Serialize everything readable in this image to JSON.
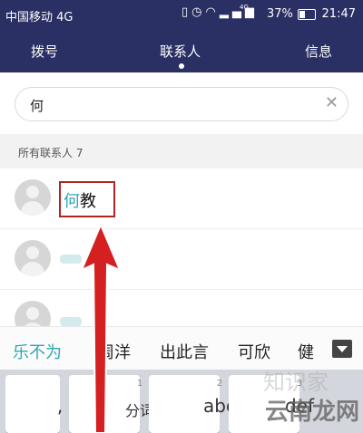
{
  "status": {
    "carrier": "中国移动 4G",
    "network": "4G",
    "battery": "37%",
    "time": "21:47"
  },
  "tabs": [
    {
      "label": "拨号"
    },
    {
      "label": "联系人"
    },
    {
      "label": "信息"
    }
  ],
  "search": {
    "value": "何"
  },
  "section": {
    "header": "所有联系人  7"
  },
  "contacts": [
    {
      "match": "何",
      "rest": "教"
    }
  ],
  "suggestions": [
    "乐不为",
    "周洋",
    "出此言",
    "可欣",
    "健"
  ],
  "keyboard": {
    "keys": [
      {
        "num": "",
        "label": ","
      },
      {
        "num": "1",
        "label": "分词"
      },
      {
        "num": "2",
        "label": "abc"
      },
      {
        "num": "3",
        "label": "def"
      }
    ]
  },
  "watermark": {
    "top": "知识家",
    "bottom": "云南龙网"
  },
  "colors": {
    "header_bg": "#2a2f64",
    "accent": "#2fa7b5",
    "annotation_red": "#d42020"
  }
}
